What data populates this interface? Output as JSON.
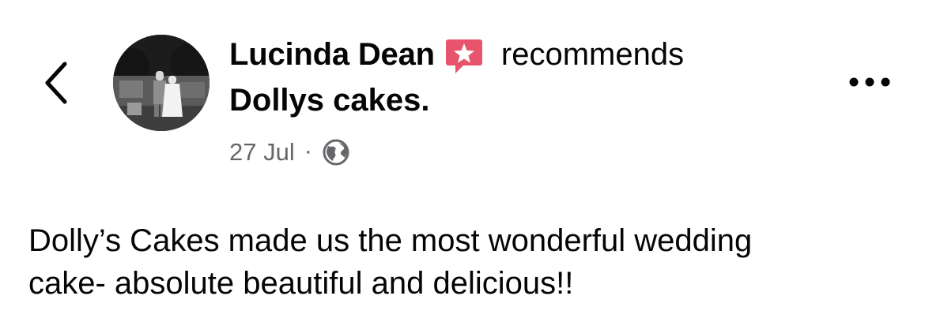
{
  "post": {
    "author_name": "Lucinda Dean",
    "action": "recommends",
    "page_name": "Dollys cakes.",
    "date": "27 Jul",
    "separator": "·",
    "audience_icon": "globe-icon",
    "body_lines": [
      "Dolly’s Cakes made us the most wonderful wedding",
      "cake- absolute beautiful and delicious!!"
    ]
  },
  "icons": {
    "back": "chevron-left-icon",
    "more": "more-dots-icon",
    "recommend": "recommend-star-icon"
  },
  "colors": {
    "text_primary": "#050505",
    "text_secondary": "#65676b",
    "recommend_accent": "#e8546c",
    "background": "#ffffff"
  }
}
